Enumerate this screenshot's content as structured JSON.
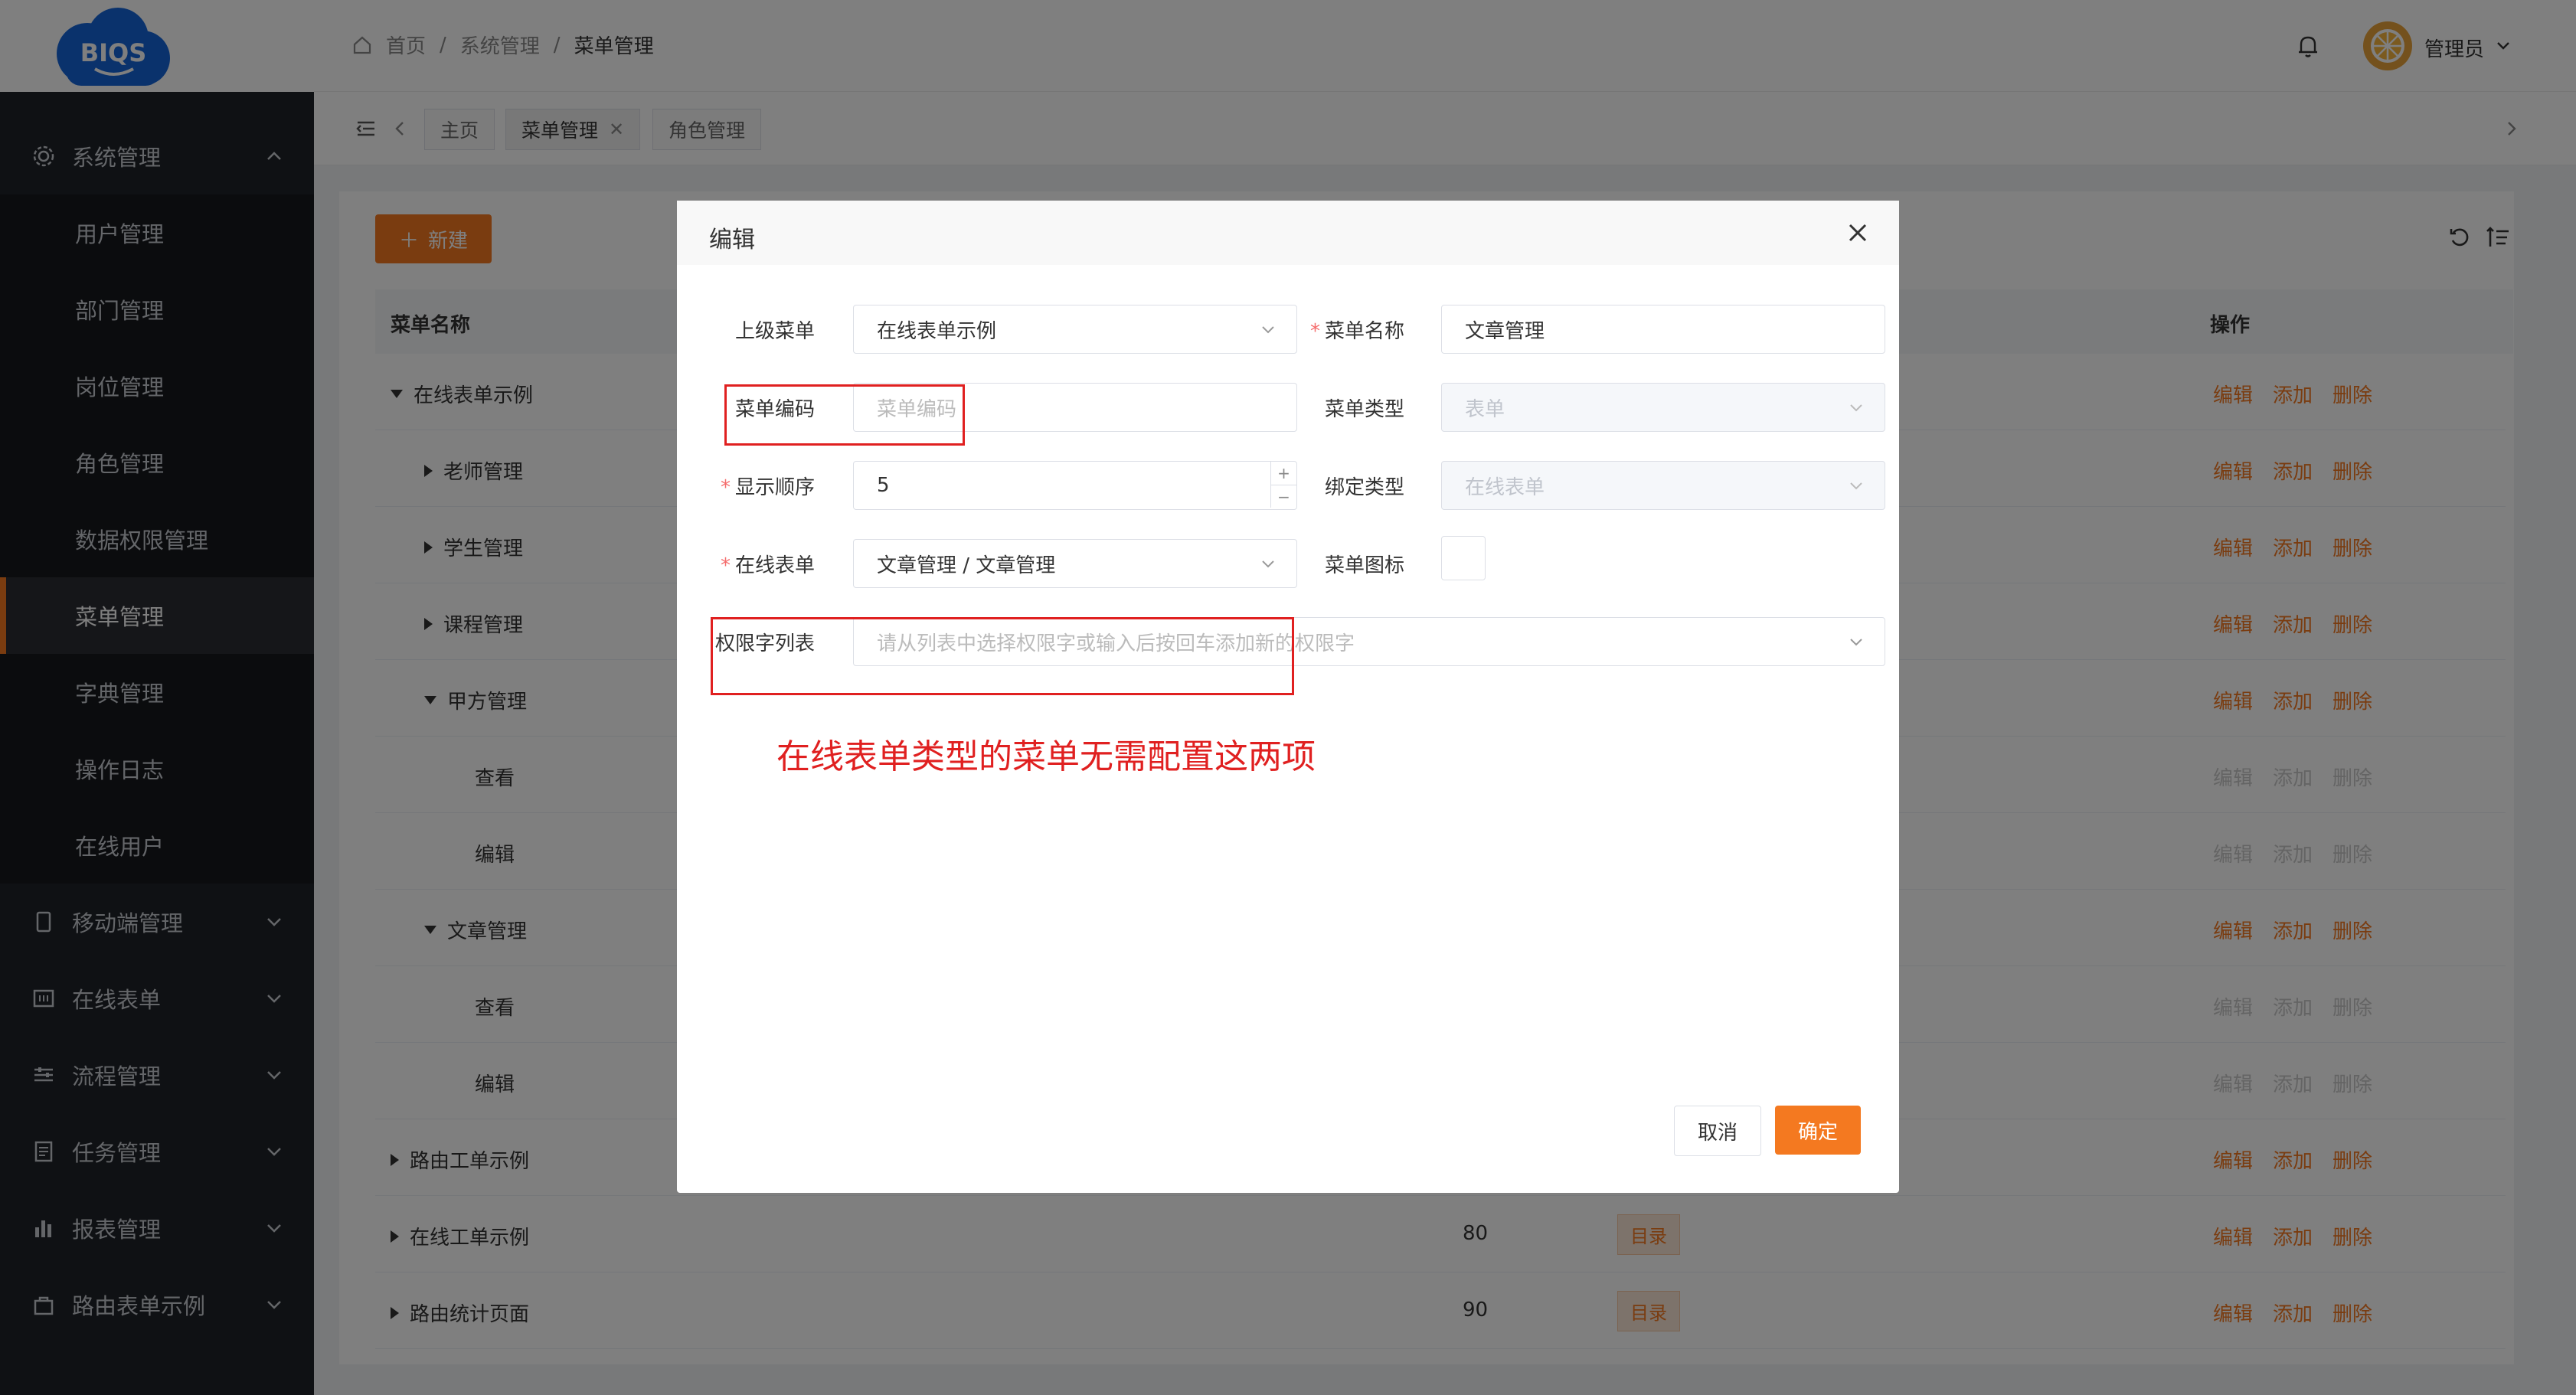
{
  "brand": {
    "logo_text": "BIQS",
    "accent": "#f47920"
  },
  "sidebar": {
    "groups": [
      {
        "label": "系统管理",
        "icon": "gear-icon"
      },
      {
        "label": "移动端管理",
        "icon": "mobile-icon"
      },
      {
        "label": "在线表单",
        "icon": "form-icon"
      },
      {
        "label": "流程管理",
        "icon": "sliders-icon"
      },
      {
        "label": "任务管理",
        "icon": "task-icon"
      },
      {
        "label": "报表管理",
        "icon": "bar-chart-icon"
      },
      {
        "label": "路由表单示例",
        "icon": "bag-icon"
      }
    ],
    "sub_items": [
      "用户管理",
      "部门管理",
      "岗位管理",
      "角色管理",
      "数据权限管理",
      "菜单管理",
      "字典管理",
      "操作日志",
      "在线用户"
    ],
    "active": "菜单管理"
  },
  "header": {
    "breadcrumb": [
      "首页",
      "系统管理",
      "菜单管理"
    ],
    "user": "管理员"
  },
  "tabs": [
    "主页",
    "菜单管理",
    "角色管理"
  ],
  "toolbar": {
    "new_label": "新建"
  },
  "table": {
    "col_name": "菜单名称",
    "col_ops": "操作",
    "rows": [
      {
        "name": "在线表单示例",
        "expand": "down",
        "level": 0
      },
      {
        "name": "老师管理",
        "expand": "right",
        "level": 1
      },
      {
        "name": "学生管理",
        "expand": "right",
        "level": 1
      },
      {
        "name": "课程管理",
        "expand": "right",
        "level": 1
      },
      {
        "name": "甲方管理",
        "expand": "down",
        "level": 1
      },
      {
        "name": "查看",
        "expand": "",
        "level": 2
      },
      {
        "name": "编辑",
        "expand": "",
        "level": 2
      },
      {
        "name": "文章管理",
        "expand": "down",
        "level": 1
      },
      {
        "name": "查看",
        "expand": "",
        "level": 2
      },
      {
        "name": "编辑",
        "expand": "",
        "level": 2
      },
      {
        "name": "路由工单示例",
        "expand": "right",
        "level": 0
      },
      {
        "name": "在线工单示例",
        "expand": "right",
        "level": 0,
        "order": "80",
        "type": "目录"
      },
      {
        "name": "路由统计页面",
        "expand": "right",
        "level": 0,
        "order": "90",
        "type": "目录"
      }
    ],
    "ops": {
      "edit": "编辑",
      "add": "添加",
      "delete": "删除"
    }
  },
  "modal": {
    "title": "编辑",
    "fields": {
      "parent_label": "上级菜单",
      "parent_value": "在线表单示例",
      "name_label": "菜单名称",
      "name_value": "文章管理",
      "code_label": "菜单编码",
      "code_placeholder": "菜单编码",
      "type_label": "菜单类型",
      "type_value": "表单",
      "order_label": "显示顺序",
      "order_value": "5",
      "bind_label": "绑定类型",
      "bind_value": "在线表单",
      "form_label": "在线表单",
      "form_value": "文章管理 / 文章管理",
      "icon_label": "菜单图标",
      "perm_label": "权限字列表",
      "perm_placeholder": "请从列表中选择权限字或输入后按回车添加新的权限字"
    },
    "note": "在线表单类型的菜单无需配置这两项",
    "cancel": "取消",
    "confirm": "确定"
  }
}
